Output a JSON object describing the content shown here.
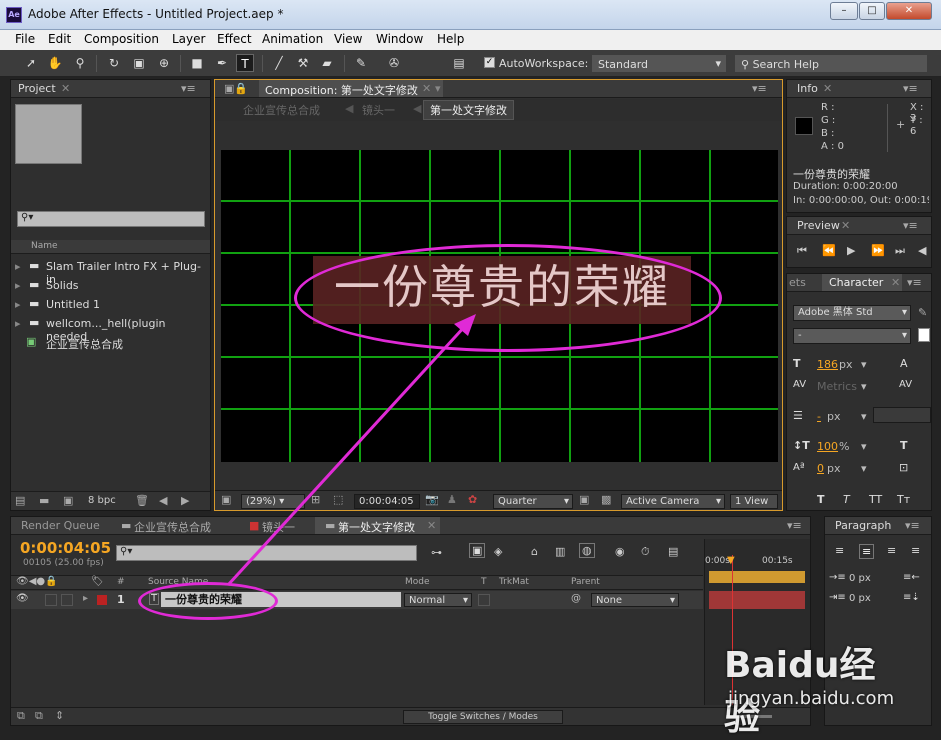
{
  "window": {
    "logo": "Ae",
    "title": "Adobe After Effects - Untitled Project.aep *",
    "minimize": "–",
    "maximize": "□",
    "close": "✕"
  },
  "menu": [
    "File",
    "Edit",
    "Composition",
    "Layer",
    "Effect",
    "Animation",
    "View",
    "Window",
    "Help"
  ],
  "toolbar": {
    "autoworkspace_label": "AutoWorkspace:",
    "workspace_value": "Standard",
    "search_placeholder": "Search Help"
  },
  "project": {
    "tab": "Project",
    "search_placeholder": "",
    "column_name": "Name",
    "items": [
      "Slam Trailer Intro FX + Plug-in",
      "Solids",
      "Untitled 1",
      "wellcom..._hell(plugin needed",
      "企业宣传总合成"
    ],
    "bpc": "8 bpc"
  },
  "composition": {
    "tab": "Composition: 第一处文字修改",
    "breadcrumbs": [
      "企业宣传总合成",
      "镜头一",
      "第一处文字修改"
    ],
    "text": "一份尊贵的荣耀",
    "zoom": "(29%)",
    "timecode": "0:00:04:05",
    "resolution": "Quarter",
    "camera": "Active Camera",
    "views": "1 View"
  },
  "info": {
    "tab": "Info",
    "r": "R :",
    "g": "G :",
    "b": "B :",
    "a": "A : 0",
    "x": "X : 3",
    "y": "Y : 6",
    "layer_name": "一份尊贵的荣耀",
    "duration": "Duration: 0:00:20:00",
    "inout": "In: 0:00:00:00, Out: 0:00:19"
  },
  "preview": {
    "tab": "Preview"
  },
  "character": {
    "tab_left": "ets",
    "tab": "Character",
    "font": "Adobe 黑体 Std",
    "style": "-",
    "size": "186",
    "size_unit": "px",
    "metrics": "Metrics",
    "leading_unit": "px",
    "leading": "-",
    "scale": "100",
    "scale_unit": "%",
    "baseline": "0",
    "baseline_unit": "px",
    "styles": [
      "T",
      "T",
      "TT",
      "Tт"
    ]
  },
  "timeline": {
    "tabs": [
      "Render Queue",
      "企业宣传总合成",
      "镜头一",
      "第一处文字修改"
    ],
    "timecode": "0:00:04:05",
    "fps": "00105 (25.00 fps)",
    "search_placeholder": "",
    "col_num": "#",
    "col_source": "Source Name",
    "col_mode": "Mode",
    "col_t": "T",
    "col_trkmat": "TrkMat",
    "col_parent": "Parent",
    "layer_index": "1",
    "layer_name": "一份尊贵的荣耀",
    "layer_mode": "Normal",
    "layer_parent": "None",
    "ruler_0": "0:00s",
    "ruler_15": "00:15s",
    "toggle": "Toggle Switches / Modes"
  },
  "paragraph": {
    "tab": "Paragraph",
    "indent_left": "0 px",
    "indent_first": "0 px"
  },
  "watermark": {
    "brand": "Baidu经验",
    "url": "jingyan.baidu.com"
  },
  "colors": {
    "accent": "#f5a623",
    "annotation": "#e02ad6",
    "grid": "#11a111",
    "text_highlight": "#6b2a2a"
  }
}
